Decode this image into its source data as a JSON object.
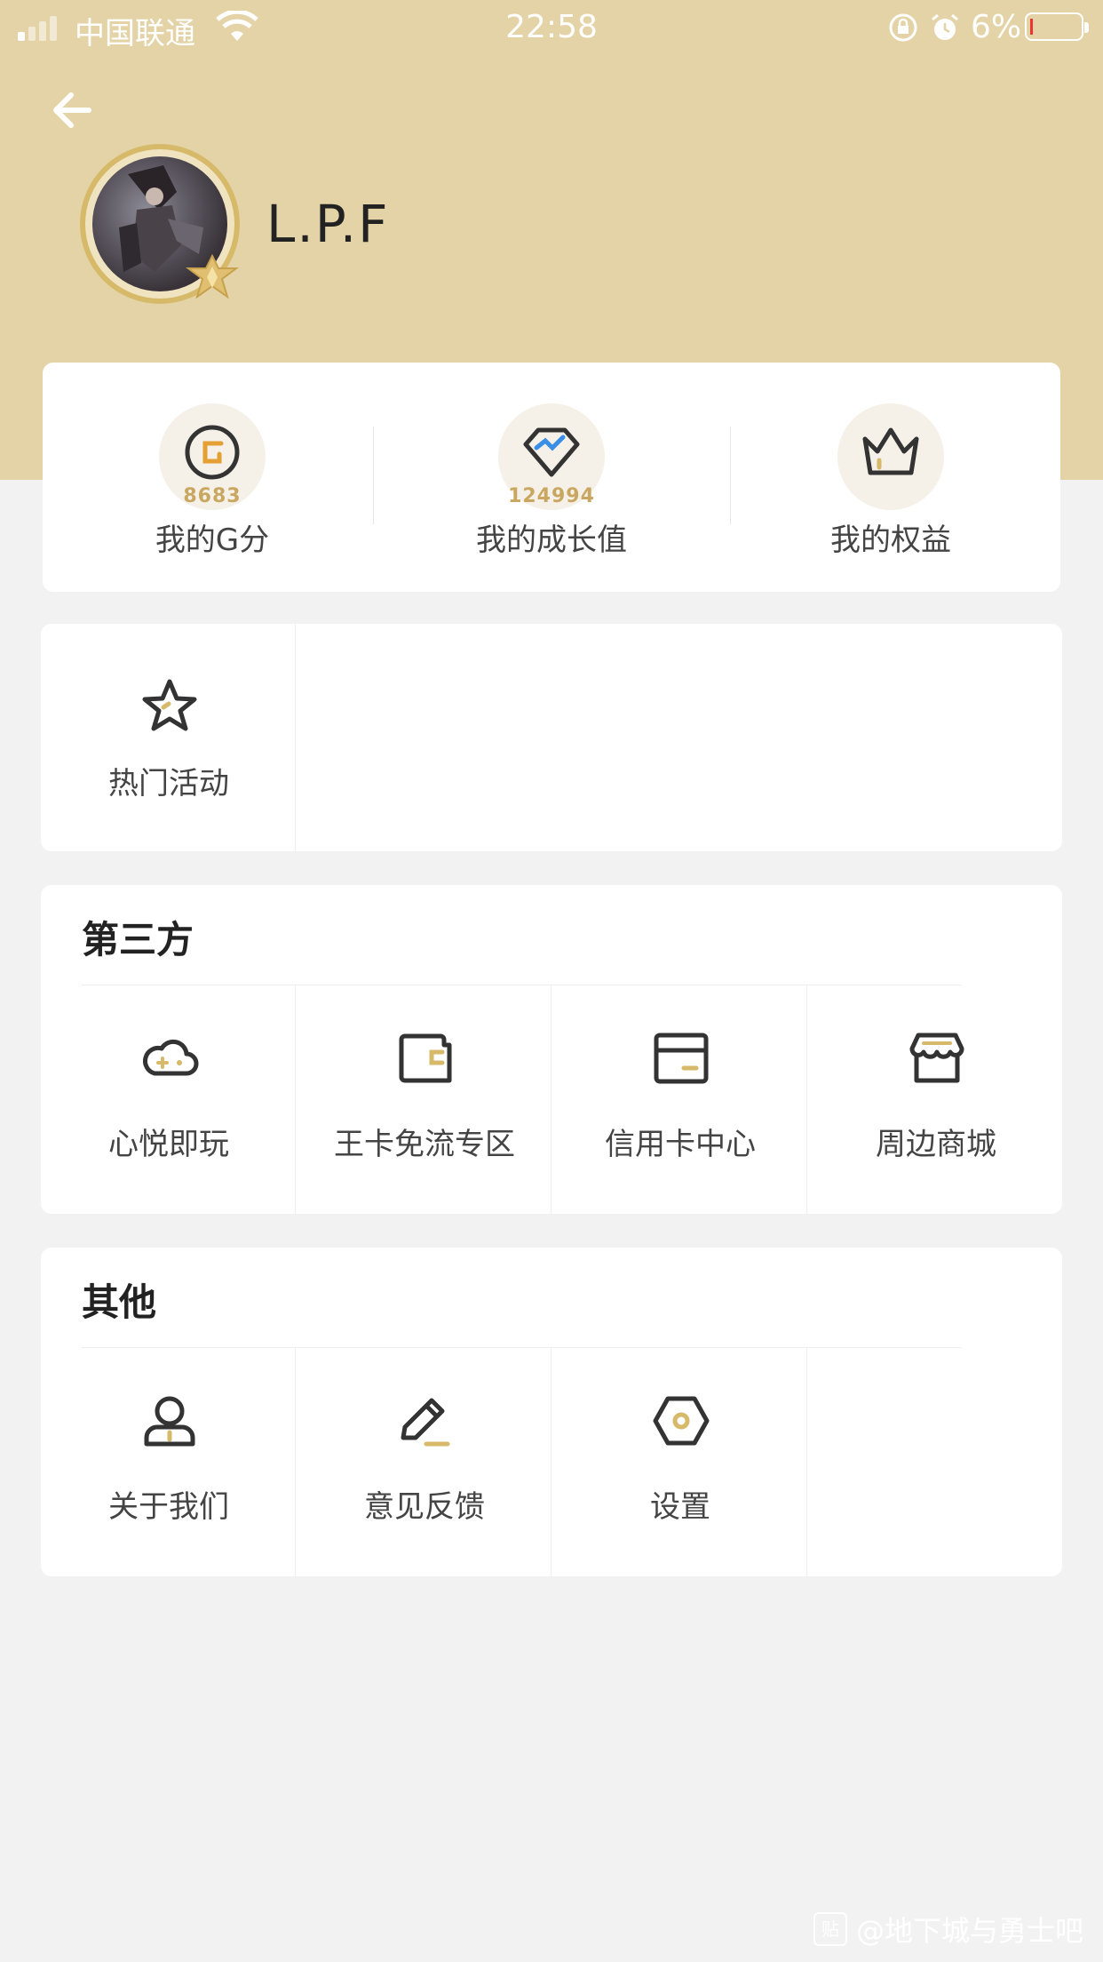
{
  "status_bar": {
    "carrier": "中国联通",
    "time": "22:58",
    "battery_percent": "6%"
  },
  "profile": {
    "username": "L.P.F"
  },
  "stats": [
    {
      "value": "8683",
      "label": "我的G分",
      "icon": "g-coin-icon"
    },
    {
      "value": "124994",
      "label": "我的成长值",
      "icon": "diamond-trend-icon"
    },
    {
      "value": "",
      "label": "我的权益",
      "icon": "crown-icon"
    }
  ],
  "hot": {
    "items": [
      {
        "label": "热门活动",
        "icon": "star-icon"
      }
    ]
  },
  "third_party": {
    "title": "第三方",
    "items": [
      {
        "label": "心悦即玩",
        "icon": "cloud-gamepad-icon"
      },
      {
        "label": "王卡免流专区",
        "icon": "wallet-card-icon"
      },
      {
        "label": "信用卡中心",
        "icon": "credit-card-icon"
      },
      {
        "label": "周边商城",
        "icon": "store-icon"
      }
    ]
  },
  "other": {
    "title": "其他",
    "items": [
      {
        "label": "关于我们",
        "icon": "person-icon"
      },
      {
        "label": "意见反馈",
        "icon": "pencil-icon"
      },
      {
        "label": "设置",
        "icon": "hexagon-settings-icon"
      }
    ]
  },
  "watermark": "@地下城与勇士吧",
  "colors": {
    "header_bg": "#e3d3a6",
    "accent_gold": "#d7b96a",
    "page_bg": "#f2f2f2"
  }
}
